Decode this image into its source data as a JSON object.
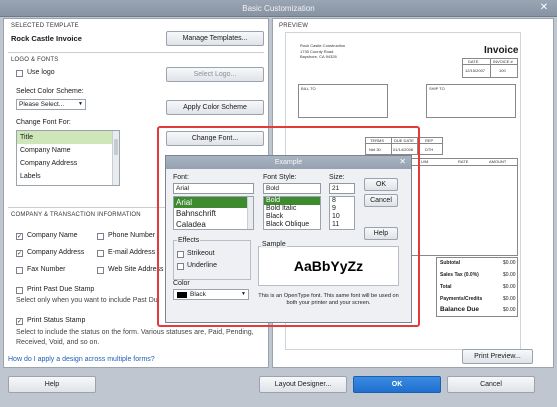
{
  "window": {
    "title": "Basic Customization",
    "close_glyph": "✕"
  },
  "left": {
    "selected_template_label": "SELECTED TEMPLATE",
    "template_name": "Rock Castle Invoice",
    "manage_templates": "Manage Templates...",
    "logo_fonts_label": "LOGO & FONTS",
    "use_logo": "Use logo",
    "select_logo": "Select Logo...",
    "select_color_scheme_label": "Select Color Scheme:",
    "color_scheme_value": "Please Select...",
    "apply_color_scheme": "Apply Color Scheme",
    "change_font_for_label": "Change Font For:",
    "font_targets": [
      "Title",
      "Company Name",
      "Company Address",
      "Labels"
    ],
    "change_font": "Change Font...",
    "company_info_label": "COMPANY & TRANSACTION INFORMATION",
    "company_fields": [
      {
        "label": "Company Name",
        "checked": true
      },
      {
        "label": "Phone Number",
        "checked": false
      },
      {
        "label": "Company Address",
        "checked": true
      },
      {
        "label": "E-mail Address",
        "checked": false
      },
      {
        "label": "Fax Number",
        "checked": false
      },
      {
        "label": "Web Site Address",
        "checked": false
      }
    ],
    "print_past_due": "Print Past Due Stamp",
    "past_due_note": "Select only when you want to include Past Du",
    "print_status": "Print Status Stamp",
    "status_note_1": "Select to include the status on the form. Various statuses are, Paid, Pending,",
    "status_note_2": "Received, Void, and so on.",
    "help_link": "How do I apply a design across multiple forms?"
  },
  "preview": {
    "label": "PREVIEW",
    "company_name": "Rock Castle Construction",
    "company_addr1": "1735 County Road",
    "company_addr2": "Bayshore, CA 94326",
    "doc_title": "Invoice",
    "date_label": "DATE",
    "invoice_label": "INVOICE #",
    "date_value": "12/15/2007",
    "invoice_value": "100",
    "bill_to": "BILL TO",
    "ship_to": "SHIP TO",
    "col_headers": [
      "TERMS",
      "DUE DATE",
      "REP"
    ],
    "col_values": [
      "Net 30",
      "01/14/2008",
      "DTH"
    ],
    "line_headers": [
      "U/M",
      "RATE",
      "AMOUNT"
    ],
    "totals": [
      {
        "label": "Subtotal",
        "value": "$0.00"
      },
      {
        "label": "Sales Tax (0.0%)",
        "value": "$0.00"
      },
      {
        "label": "Total",
        "value": "$0.00"
      },
      {
        "label": "Payments/Credits",
        "value": "$0.00"
      },
      {
        "label": "Balance Due",
        "value": "$0.00"
      }
    ],
    "print_preview": "Print Preview..."
  },
  "footer": {
    "help": "Help",
    "layout_designer": "Layout Designer...",
    "ok": "OK",
    "cancel": "Cancel"
  },
  "dialog": {
    "title": "Example",
    "font_label": "Font:",
    "font_value": "Arial",
    "fonts": [
      "Arial",
      "Bahnschrift",
      "Caladea"
    ],
    "style_label": "Font Style:",
    "style_value": "Bold",
    "styles": [
      "Bold",
      "Bold Italic",
      "Black",
      "Black Oblique"
    ],
    "size_label": "Size:",
    "size_value": "21",
    "sizes": [
      "8",
      "9",
      "10",
      "11"
    ],
    "ok": "OK",
    "cancel": "Cancel",
    "help": "Help",
    "effects_label": "Effects",
    "strikeout": "Strikeout",
    "underline": "Underline",
    "color_label": "Color",
    "color_value": "Black",
    "sample_label": "Sample",
    "sample_text": "AaBbYyZz",
    "sample_note": "This is an OpenType font. This same font will be used on both your printer and your screen.",
    "close_glyph": "✕"
  },
  "colors": {
    "highlight": "#e23b3b",
    "selection_green": "#cfe6b8",
    "ok_blue": "#1f6fcf"
  }
}
